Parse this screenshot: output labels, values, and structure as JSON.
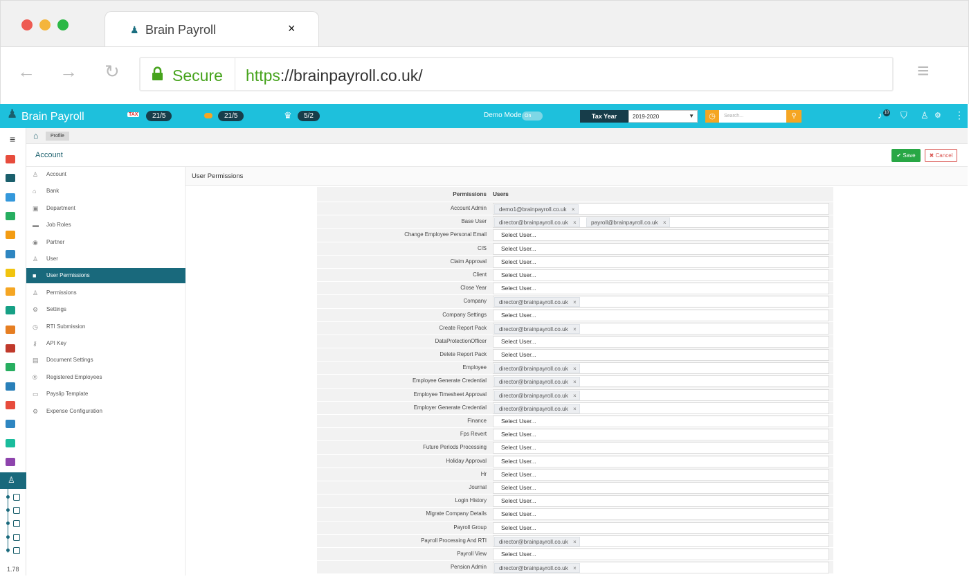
{
  "browser": {
    "tab_title": "Brain Payroll",
    "tab_close": "×",
    "secure_label": "Secure",
    "url_https": "https",
    "url_rest": "://brainpayroll.co.uk/",
    "back": "←",
    "forward": "→",
    "reload": "↻",
    "menu": "≡"
  },
  "app": {
    "brand": "Brain Payroll",
    "counter1": "21/5",
    "counter2": "21/5",
    "counter3": "5/2",
    "demo_label": "Demo Mode",
    "demo_toggle": "On",
    "tax_year_label": "Tax Year",
    "tax_year_value": "2019-2020",
    "search_placeholder": "Search...",
    "notif_count": "10",
    "version": "1.78"
  },
  "breadcrumb": {
    "item": "Profile"
  },
  "account": {
    "title": "Account",
    "save": "Save",
    "cancel": "Cancel"
  },
  "submenu": [
    {
      "label": "Account",
      "icon": "user-icon"
    },
    {
      "label": "Bank",
      "icon": "bank-icon"
    },
    {
      "label": "Department",
      "icon": "department-icon"
    },
    {
      "label": "Job Roles",
      "icon": "briefcase-icon"
    },
    {
      "label": "Partner",
      "icon": "eye-icon"
    },
    {
      "label": "User",
      "icon": "user-icon"
    },
    {
      "label": "User Permissions",
      "icon": "lock-icon"
    },
    {
      "label": "Permissions",
      "icon": "user-plus-icon"
    },
    {
      "label": "Settings",
      "icon": "gears-icon"
    },
    {
      "label": "RTI Submission",
      "icon": "clock-icon"
    },
    {
      "label": "API Key",
      "icon": "key-icon"
    },
    {
      "label": "Document Settings",
      "icon": "book-icon"
    },
    {
      "label": "Registered Employees",
      "icon": "registered-icon"
    },
    {
      "label": "Payslip Template",
      "icon": "card-icon"
    },
    {
      "label": "Expense Configuration",
      "icon": "gear-icon"
    }
  ],
  "panel": {
    "title": "User Permissions",
    "col_permissions": "Permissions",
    "col_users": "Users",
    "placeholder": "Select User..."
  },
  "permissions": [
    {
      "name": "Account Admin",
      "users": [
        "demo1@brainpayroll.co.uk"
      ]
    },
    {
      "name": "Base User",
      "users": [
        "director@brainpayroll.co.uk",
        "payroll@brainpayroll.co.uk"
      ]
    },
    {
      "name": "Change Employee Personal Email",
      "users": []
    },
    {
      "name": "CIS",
      "users": []
    },
    {
      "name": "Claim Approval",
      "users": []
    },
    {
      "name": "Client",
      "users": []
    },
    {
      "name": "Close Year",
      "users": []
    },
    {
      "name": "Company",
      "users": [
        "director@brainpayroll.co.uk"
      ]
    },
    {
      "name": "Company Settings",
      "users": []
    },
    {
      "name": "Create Report Pack",
      "users": [
        "director@brainpayroll.co.uk"
      ]
    },
    {
      "name": "DataProtectionOfficer",
      "users": []
    },
    {
      "name": "Delete Report Pack",
      "users": []
    },
    {
      "name": "Employee",
      "users": [
        "director@brainpayroll.co.uk"
      ]
    },
    {
      "name": "Employee Generate Credential",
      "users": [
        "director@brainpayroll.co.uk"
      ]
    },
    {
      "name": "Employee Timesheet Approval",
      "users": [
        "director@brainpayroll.co.uk"
      ]
    },
    {
      "name": "Employer Generate Credential",
      "users": [
        "director@brainpayroll.co.uk"
      ]
    },
    {
      "name": "Finance",
      "users": []
    },
    {
      "name": "Fps Revert",
      "users": []
    },
    {
      "name": "Future Periods Processing",
      "users": []
    },
    {
      "name": "Holiday Approval",
      "users": []
    },
    {
      "name": "Hr",
      "users": []
    },
    {
      "name": "Journal",
      "users": []
    },
    {
      "name": "Login History",
      "users": []
    },
    {
      "name": "Migrate Company Details",
      "users": []
    },
    {
      "name": "Payroll Group",
      "users": []
    },
    {
      "name": "Payroll Processing And RTI",
      "users": [
        "director@brainpayroll.co.uk"
      ]
    },
    {
      "name": "Payroll View",
      "users": []
    },
    {
      "name": "Pension Admin",
      "users": [
        "director@brainpayroll.co.uk"
      ]
    }
  ],
  "colors": {
    "header": "#1ec0dc",
    "active": "#19697c",
    "save": "#28a745",
    "cancel": "#d9534f"
  }
}
